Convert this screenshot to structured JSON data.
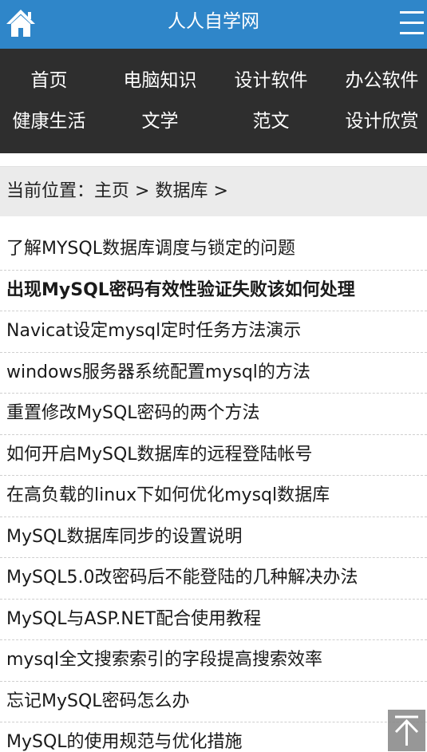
{
  "header": {
    "title": "人人自学网",
    "home_icon": "home-icon",
    "menu_icon": "hamburger-menu-icon",
    "background_color": "#2f86c9"
  },
  "nav": {
    "background_color": "#2e2e2e",
    "items": [
      {
        "label": "首页"
      },
      {
        "label": "电脑知识"
      },
      {
        "label": "设计软件"
      },
      {
        "label": "办公软件"
      },
      {
        "label": "健康生活"
      },
      {
        "label": "文学"
      },
      {
        "label": "范文"
      },
      {
        "label": "设计欣赏"
      }
    ]
  },
  "breadcrumb": {
    "prefix": "当前位置：",
    "home": "主页",
    "separator": " > ",
    "current": "数据库",
    "trailing": " >"
  },
  "articles": [
    {
      "title": "了解MYSQL数据库调度与锁定的问题"
    },
    {
      "title": "出现MySQL密码有效性验证失败该如何处理"
    },
    {
      "title": "Navicat设定mysql定时任务方法演示"
    },
    {
      "title": "windows服务器系统配置mysql的方法"
    },
    {
      "title": "重置修改MySQL密码的两个方法"
    },
    {
      "title": "如何开启MySQL数据库的远程登陆帐号"
    },
    {
      "title": "在高负载的linux下如何优化mysql数据库"
    },
    {
      "title": "MySQL数据库同步的设置说明"
    },
    {
      "title": "MySQL5.0改密码后不能登陆的几种解决办法"
    },
    {
      "title": "MySQL与ASP.NET配合使用教程"
    },
    {
      "title": "mysql全文搜索索引的字段提高搜索效率"
    },
    {
      "title": "忘记MySQL密码怎么办"
    },
    {
      "title": "MySQL的使用规范与优化措施"
    }
  ],
  "back_to_top": {
    "icon": "arrow-up-icon"
  }
}
